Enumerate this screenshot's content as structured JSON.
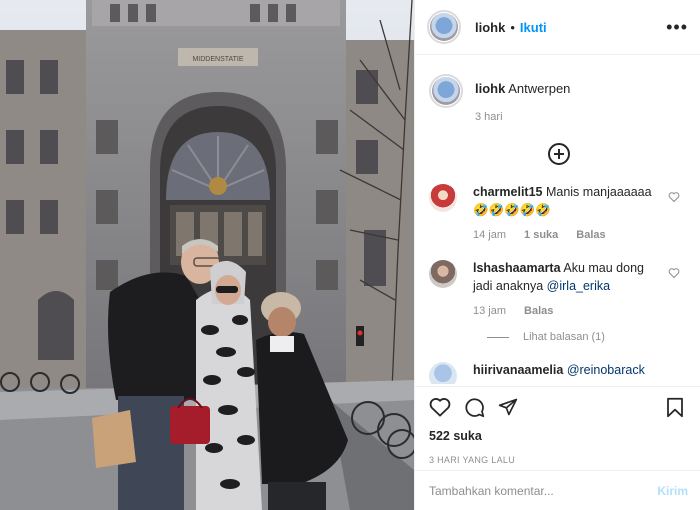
{
  "post": {
    "username": "liohk",
    "follow_label": "Ikuti",
    "more_label": "•••",
    "caption": {
      "username": "liohk",
      "text": "Antwerpen",
      "time": "3 hari"
    },
    "photo_sign": "MIDDENSTATIE"
  },
  "comments": [
    {
      "username": "charmelit15",
      "text": "Manis manjaaaaaa 🤣🤣🤣🤣🤣",
      "time": "14 jam",
      "likes": "1 suka",
      "reply": "Balas"
    },
    {
      "username": "lshashaamarta",
      "text": "Aku mau dong jadi anaknya ",
      "mention": "@irla_erika",
      "time": "13 jam",
      "reply": "Balas",
      "view_replies": "Lihat balasan (1)"
    },
    {
      "username": "hiirivanaamelia",
      "mention": "@reinobarack"
    }
  ],
  "actions": {
    "likes": "522 suka",
    "date": "3 HARI YANG LALU"
  },
  "comment_box": {
    "placeholder": "Tambahkan komentar...",
    "post_label": "Kirim"
  },
  "colors": {
    "follow": "#0095f6",
    "post_disabled": "#b2dffc",
    "muted": "#8e8e8e"
  }
}
